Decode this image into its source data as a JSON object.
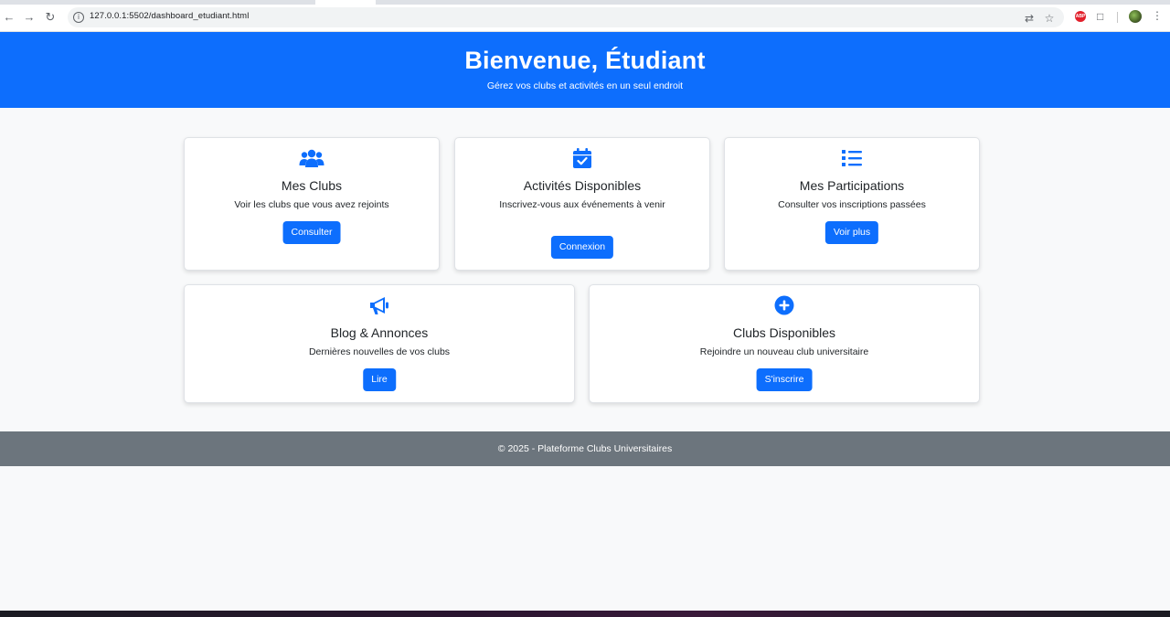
{
  "browser": {
    "url": "127.0.0.1:5502/dashboard_etudiant.html",
    "back_icon": "arrow-left-icon",
    "forward_icon": "arrow-right-icon",
    "reload_icon": "reload-icon",
    "ext_badge": "ABP"
  },
  "header": {
    "title": "Bienvenue, Étudiant",
    "subtitle": "Gérez vos clubs et activités en un seul endroit",
    "bg_color": "#0d6efd"
  },
  "cards": [
    {
      "icon": "users-icon",
      "title": "Mes Clubs",
      "text": "Voir les clubs que vous avez rejoints",
      "button": "Consulter"
    },
    {
      "icon": "calendar-check-icon",
      "title": "Activités Disponibles",
      "text": "Inscrivez-vous aux événements à venir",
      "button": "Connexion"
    },
    {
      "icon": "list-icon",
      "title": "Mes Participations",
      "text": "Consulter vos inscriptions passées",
      "button": "Voir plus"
    },
    {
      "icon": "megaphone-icon",
      "title": "Blog & Annonces",
      "text": "Dernières nouvelles de vos clubs",
      "button": "Lire"
    },
    {
      "icon": "plus-circle-icon",
      "title": "Clubs Disponibles",
      "text": "Rejoindre un nouveau club universitaire",
      "button": "S'inscrire"
    }
  ],
  "footer": {
    "text": "© 2025 - Plateforme Clubs Universitaires"
  },
  "colors": {
    "primary": "#0d6efd",
    "footer_bg": "#6c757d",
    "page_bg": "#f8f9fa"
  }
}
